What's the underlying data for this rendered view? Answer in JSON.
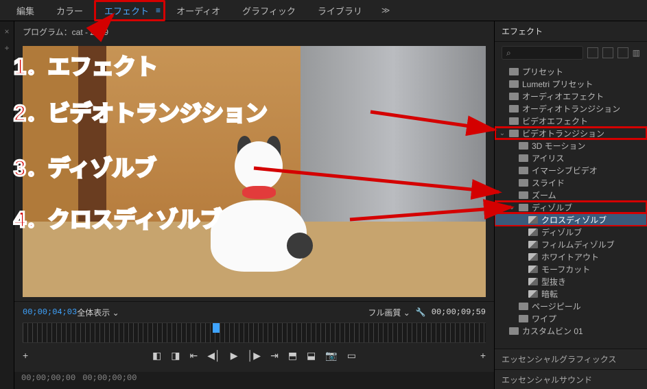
{
  "topbar": {
    "tabs": [
      "編集",
      "カラー",
      "エフェクト",
      "オーディオ",
      "グラフィック",
      "ライブラリ"
    ],
    "active_index": 2,
    "more": "≫"
  },
  "program": {
    "title": "プログラム：cat - 2879",
    "current_tc": "00;00;04;03",
    "fit_label": "全体表示",
    "view_label": "フル画質",
    "duration_tc": "00;00;09;59",
    "transport_icons": [
      "mark-in",
      "mark-out",
      "go-in",
      "step-back",
      "play",
      "step-fwd",
      "go-out",
      "lift",
      "extract",
      "export-frame",
      "safe-margins"
    ]
  },
  "timeline": {
    "tc1": "00;00;00;00",
    "tc2": "00;00;00;00"
  },
  "effects": {
    "title": "エフェクト",
    "search_placeholder": "",
    "root": [
      {
        "label": "プリセット"
      },
      {
        "label": "Lumetri プリセット"
      },
      {
        "label": "オーディオエフェクト"
      },
      {
        "label": "オーディオトランジション"
      },
      {
        "label": "ビデオエフェクト"
      },
      {
        "label": "ビデオトランジション",
        "open": true,
        "highlight": true,
        "children": [
          {
            "label": "3D モーション"
          },
          {
            "label": "アイリス"
          },
          {
            "label": "イマーシブビデオ"
          },
          {
            "label": "スライド"
          },
          {
            "label": "ズーム"
          },
          {
            "label": "ディゾルブ",
            "open": true,
            "highlight": true,
            "children": [
              {
                "label": "クロスディゾルブ",
                "fx": true,
                "selected": true,
                "highlight": true
              },
              {
                "label": "ディゾルブ",
                "fx": true
              },
              {
                "label": "フィルムディゾルブ",
                "fx": true
              },
              {
                "label": "ホワイトアウト",
                "fx": true
              },
              {
                "label": "モーフカット",
                "fx": true
              },
              {
                "label": "型抜き",
                "fx": true
              },
              {
                "label": "暗転",
                "fx": true
              }
            ]
          },
          {
            "label": "ページピール"
          },
          {
            "label": "ワイプ"
          }
        ]
      },
      {
        "label": "カスタムビン 01"
      }
    ]
  },
  "side_panels": {
    "ess_graphics": "エッセンシャルグラフィックス",
    "ess_sound": "エッセンシャルサウンド"
  },
  "annotations": {
    "a1": "1．エフェクト",
    "a2": "2．ビデオトランジション",
    "a3": "3．ディゾルブ",
    "a4": "4．クロスディゾルブ"
  }
}
